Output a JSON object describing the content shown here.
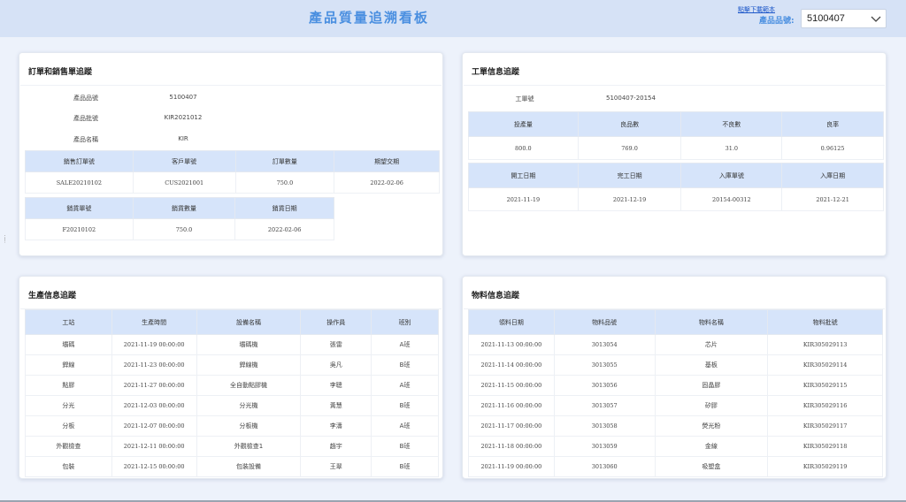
{
  "header": {
    "title": "產品質量追溯看板",
    "download_link": "點擊下載範本",
    "product_label": "產品品號:",
    "product_value": "5100407"
  },
  "order_panel": {
    "title": "訂單和銷售單追蹤",
    "fields": [
      {
        "label": "產品品號",
        "value": "5100407"
      },
      {
        "label": "產品批號",
        "value": "KIR2021012"
      },
      {
        "label": "產品名稱",
        "value": "KIR"
      }
    ],
    "order_table": {
      "headers": [
        "銷售訂單號",
        "客戶單號",
        "訂單數量",
        "期望交期"
      ],
      "rows": [
        [
          "SALE20210102",
          "CUS2021001",
          "750.0",
          "2022-02-06"
        ]
      ]
    },
    "sales_table": {
      "headers": [
        "銷貨單號",
        "銷貨數量",
        "銷貨日期"
      ],
      "rows": [
        [
          "F20210102",
          "750.0",
          "2022-02-06"
        ]
      ]
    }
  },
  "work_panel": {
    "title": "工單信息追蹤",
    "field": {
      "label": "工單號",
      "value": "5100407-20154"
    },
    "qty_table": {
      "headers": [
        "投產量",
        "良品數",
        "不良數",
        "良率"
      ],
      "rows": [
        [
          "800.0",
          "769.0",
          "31.0",
          "0.96125"
        ]
      ]
    },
    "date_table": {
      "headers": [
        "開工日期",
        "完工日期",
        "入庫單號",
        "入庫日期"
      ],
      "rows": [
        [
          "2021-11-19",
          "2021-12-19",
          "20154-00312",
          "2021-12-21"
        ]
      ]
    }
  },
  "production_panel": {
    "title": "生產信息追蹤",
    "headers": [
      "工站",
      "生產時間",
      "設備名稱",
      "操作員",
      "班別"
    ],
    "rows": [
      [
        "壩碼",
        "2021-11-19 00:00:00",
        "壩碼機",
        "張雷",
        "A班"
      ],
      [
        "銲線",
        "2021-11-23 00:00:00",
        "銲線機",
        "吳凡",
        "B班"
      ],
      [
        "點膠",
        "2021-11-27 00:00:00",
        "全自動點膠機",
        "李聰",
        "A班"
      ],
      [
        "分光",
        "2021-12-03 00:00:00",
        "分光機",
        "黃慧",
        "B班"
      ],
      [
        "分板",
        "2021-12-07 00:00:00",
        "分板機",
        "李濤",
        "A班"
      ],
      [
        "外觀檢查",
        "2021-12-11 00:00:00",
        "外觀檢查1",
        "趙宇",
        "B班"
      ],
      [
        "包裝",
        "2021-12-15 00:00:00",
        "包裝設備",
        "王翠",
        "B班"
      ]
    ]
  },
  "material_panel": {
    "title": "物料信息追蹤",
    "headers": [
      "領料日期",
      "物料品號",
      "物料名稱",
      "物料批號"
    ],
    "rows": [
      [
        "2021-11-13 00:00:00",
        "3013054",
        "芯片",
        "KIR305029113"
      ],
      [
        "2021-11-14 00:00:00",
        "3013055",
        "基板",
        "KIR305029114"
      ],
      [
        "2021-11-15 00:00:00",
        "3013056",
        "固晶膠",
        "KIR305029115"
      ],
      [
        "2021-11-16 00:00:00",
        "3013057",
        "矽膠",
        "KIR305029116"
      ],
      [
        "2021-11-17 00:00:00",
        "3013058",
        "熒光粉",
        "KIR305029117"
      ],
      [
        "2021-11-18 00:00:00",
        "3013059",
        "金線",
        "KIR305029118"
      ],
      [
        "2021-11-19 00:00:00",
        "3013060",
        "吸塑盒",
        "KIR305029119"
      ]
    ]
  },
  "colors": {
    "accent": "#4a8fe0",
    "header_bg": "#d6e2f6",
    "table_header_bg": "#d6e4fa",
    "page_bg": "#edf2fb"
  },
  "icons": {
    "select_arrow": "chevron-down-icon",
    "grip": "drag-handle-icon"
  }
}
